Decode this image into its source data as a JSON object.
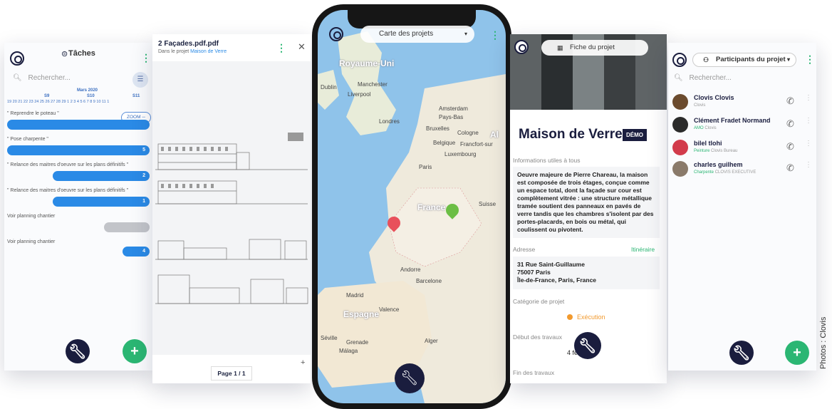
{
  "tasks": {
    "title": "Tâches",
    "search_placeholder": "Rechercher...",
    "month": "Mars 2020",
    "weeks": [
      "S9",
      "S10",
      "S11"
    ],
    "days": "19 20 21 22 23 24 25 26 27 28 29  1  2  3  4  5  6  7  8  9 10 11 1",
    "zoom_label": "ZOOM",
    "items": [
      {
        "label": "\" Reprendre le poteau \"",
        "value": ""
      },
      {
        "label": "\" Pose charpente \"",
        "value": "5"
      },
      {
        "label": "\" Relance des maitres d'oeuvre sur les plans définitifs \"",
        "value": "2"
      },
      {
        "label": "\" Relance des maitres d'oeuvre sur les plans définitifs \"",
        "value": "1"
      },
      {
        "label": "Voir planning chantier",
        "value": ""
      },
      {
        "label": "Voir planning chantier",
        "value": "4"
      }
    ]
  },
  "pdf": {
    "title": "2 Façades.pdf.pdf",
    "subtitle_prefix": "Dans le projet ",
    "project_link": "Maison de Verre",
    "pager": "Page 1 / 1",
    "zoom_in": "+"
  },
  "map": {
    "header": "Carte des projets",
    "labels": [
      {
        "text": "Royaume-Uni",
        "cls": "big"
      },
      {
        "text": "Manchester",
        "cls": ""
      },
      {
        "text": "Liverpool",
        "cls": ""
      },
      {
        "text": "Dublin",
        "cls": ""
      },
      {
        "text": "Londres",
        "cls": ""
      },
      {
        "text": "Amsterdam",
        "cls": ""
      },
      {
        "text": "Pays-Bas",
        "cls": ""
      },
      {
        "text": "Bruxelles",
        "cls": ""
      },
      {
        "text": "Cologne",
        "cls": ""
      },
      {
        "text": "Belgique",
        "cls": ""
      },
      {
        "text": "Francfort-sur",
        "cls": ""
      },
      {
        "text": "Luxembourg",
        "cls": ""
      },
      {
        "text": "Paris",
        "cls": ""
      },
      {
        "text": "France",
        "cls": "big"
      },
      {
        "text": "Suisse",
        "cls": ""
      },
      {
        "text": "Andorre",
        "cls": ""
      },
      {
        "text": "Barcelone",
        "cls": ""
      },
      {
        "text": "Madrid",
        "cls": ""
      },
      {
        "text": "Valence",
        "cls": ""
      },
      {
        "text": "Espagne",
        "cls": "big"
      },
      {
        "text": "Séville",
        "cls": ""
      },
      {
        "text": "Grenade",
        "cls": ""
      },
      {
        "text": "Málaga",
        "cls": ""
      },
      {
        "text": "Alger",
        "cls": ""
      },
      {
        "text": "Al",
        "cls": "big"
      }
    ],
    "pins": [
      {
        "color": "#e8505b"
      },
      {
        "color": "#6cbe45"
      }
    ]
  },
  "project": {
    "header": "Fiche du projet",
    "name": "Maison de Verre",
    "badge": "DÉMO",
    "info_label": "Informations utiles à tous",
    "info_text": "Oeuvre majeure de Pierre Chareau, la maison est composée de trois étages, conçue comme un espace total, dont la façade sur cour est complètement vitrée : une structure métallique tramée soutient des panneaux en pavés de verre tandis que les chambres s'isolent par des portes-placards, en bois ou métal, qui coulissent ou pivotent.",
    "address_label": "Adresse",
    "itinerary": "Itinéraire",
    "address_lines": [
      "31 Rue Saint-Guillaume",
      "75007 Paris",
      "Île-de-France, Paris, France"
    ],
    "category_label": "Catégorie de projet",
    "category_value": "Exécution",
    "start_label": "Début des travaux",
    "start_value": "4 fév 2020",
    "end_label": "Fin des travaux"
  },
  "participants": {
    "header": "Participants du projet",
    "search_placeholder": "Rechercher...",
    "people": [
      {
        "name": "Clovis Clovis",
        "role": "",
        "company": "Clovis",
        "avatar_color": "#6b4b2e"
      },
      {
        "name": "Clément Fradet Normand",
        "role": "AMO",
        "company": "Clovis",
        "avatar_color": "#2b2b2b"
      },
      {
        "name": "bilel tlohi",
        "role": "Peinture",
        "company": "Clovis Bureau",
        "avatar_color": "#d23b4b"
      },
      {
        "name": "charles guilhem",
        "role": "Charpente",
        "company": "CLOVIS EXECUTIVE",
        "avatar_color": "#8a7a6a"
      }
    ]
  },
  "credit": "Photos : Clovis",
  "colors": {
    "accent": "#2bb673",
    "navy": "#1a1d3e",
    "blue": "#2a8ae6"
  }
}
